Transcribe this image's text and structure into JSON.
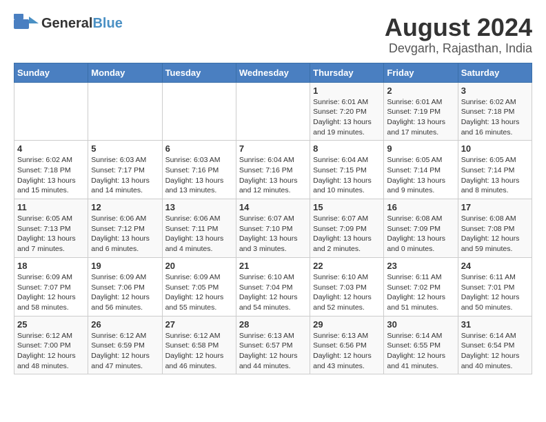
{
  "logo": {
    "general": "General",
    "blue": "Blue"
  },
  "title": "August 2024",
  "subtitle": "Devgarh, Rajasthan, India",
  "weekdays": [
    "Sunday",
    "Monday",
    "Tuesday",
    "Wednesday",
    "Thursday",
    "Friday",
    "Saturday"
  ],
  "weeks": [
    [
      {
        "day": "",
        "info": ""
      },
      {
        "day": "",
        "info": ""
      },
      {
        "day": "",
        "info": ""
      },
      {
        "day": "",
        "info": ""
      },
      {
        "day": "1",
        "info": "Sunrise: 6:01 AM\nSunset: 7:20 PM\nDaylight: 13 hours and 19 minutes."
      },
      {
        "day": "2",
        "info": "Sunrise: 6:01 AM\nSunset: 7:19 PM\nDaylight: 13 hours and 17 minutes."
      },
      {
        "day": "3",
        "info": "Sunrise: 6:02 AM\nSunset: 7:18 PM\nDaylight: 13 hours and 16 minutes."
      }
    ],
    [
      {
        "day": "4",
        "info": "Sunrise: 6:02 AM\nSunset: 7:18 PM\nDaylight: 13 hours and 15 minutes."
      },
      {
        "day": "5",
        "info": "Sunrise: 6:03 AM\nSunset: 7:17 PM\nDaylight: 13 hours and 14 minutes."
      },
      {
        "day": "6",
        "info": "Sunrise: 6:03 AM\nSunset: 7:16 PM\nDaylight: 13 hours and 13 minutes."
      },
      {
        "day": "7",
        "info": "Sunrise: 6:04 AM\nSunset: 7:16 PM\nDaylight: 13 hours and 12 minutes."
      },
      {
        "day": "8",
        "info": "Sunrise: 6:04 AM\nSunset: 7:15 PM\nDaylight: 13 hours and 10 minutes."
      },
      {
        "day": "9",
        "info": "Sunrise: 6:05 AM\nSunset: 7:14 PM\nDaylight: 13 hours and 9 minutes."
      },
      {
        "day": "10",
        "info": "Sunrise: 6:05 AM\nSunset: 7:14 PM\nDaylight: 13 hours and 8 minutes."
      }
    ],
    [
      {
        "day": "11",
        "info": "Sunrise: 6:05 AM\nSunset: 7:13 PM\nDaylight: 13 hours and 7 minutes."
      },
      {
        "day": "12",
        "info": "Sunrise: 6:06 AM\nSunset: 7:12 PM\nDaylight: 13 hours and 6 minutes."
      },
      {
        "day": "13",
        "info": "Sunrise: 6:06 AM\nSunset: 7:11 PM\nDaylight: 13 hours and 4 minutes."
      },
      {
        "day": "14",
        "info": "Sunrise: 6:07 AM\nSunset: 7:10 PM\nDaylight: 13 hours and 3 minutes."
      },
      {
        "day": "15",
        "info": "Sunrise: 6:07 AM\nSunset: 7:09 PM\nDaylight: 13 hours and 2 minutes."
      },
      {
        "day": "16",
        "info": "Sunrise: 6:08 AM\nSunset: 7:09 PM\nDaylight: 13 hours and 0 minutes."
      },
      {
        "day": "17",
        "info": "Sunrise: 6:08 AM\nSunset: 7:08 PM\nDaylight: 12 hours and 59 minutes."
      }
    ],
    [
      {
        "day": "18",
        "info": "Sunrise: 6:09 AM\nSunset: 7:07 PM\nDaylight: 12 hours and 58 minutes."
      },
      {
        "day": "19",
        "info": "Sunrise: 6:09 AM\nSunset: 7:06 PM\nDaylight: 12 hours and 56 minutes."
      },
      {
        "day": "20",
        "info": "Sunrise: 6:09 AM\nSunset: 7:05 PM\nDaylight: 12 hours and 55 minutes."
      },
      {
        "day": "21",
        "info": "Sunrise: 6:10 AM\nSunset: 7:04 PM\nDaylight: 12 hours and 54 minutes."
      },
      {
        "day": "22",
        "info": "Sunrise: 6:10 AM\nSunset: 7:03 PM\nDaylight: 12 hours and 52 minutes."
      },
      {
        "day": "23",
        "info": "Sunrise: 6:11 AM\nSunset: 7:02 PM\nDaylight: 12 hours and 51 minutes."
      },
      {
        "day": "24",
        "info": "Sunrise: 6:11 AM\nSunset: 7:01 PM\nDaylight: 12 hours and 50 minutes."
      }
    ],
    [
      {
        "day": "25",
        "info": "Sunrise: 6:12 AM\nSunset: 7:00 PM\nDaylight: 12 hours and 48 minutes."
      },
      {
        "day": "26",
        "info": "Sunrise: 6:12 AM\nSunset: 6:59 PM\nDaylight: 12 hours and 47 minutes."
      },
      {
        "day": "27",
        "info": "Sunrise: 6:12 AM\nSunset: 6:58 PM\nDaylight: 12 hours and 46 minutes."
      },
      {
        "day": "28",
        "info": "Sunrise: 6:13 AM\nSunset: 6:57 PM\nDaylight: 12 hours and 44 minutes."
      },
      {
        "day": "29",
        "info": "Sunrise: 6:13 AM\nSunset: 6:56 PM\nDaylight: 12 hours and 43 minutes."
      },
      {
        "day": "30",
        "info": "Sunrise: 6:14 AM\nSunset: 6:55 PM\nDaylight: 12 hours and 41 minutes."
      },
      {
        "day": "31",
        "info": "Sunrise: 6:14 AM\nSunset: 6:54 PM\nDaylight: 12 hours and 40 minutes."
      }
    ]
  ]
}
